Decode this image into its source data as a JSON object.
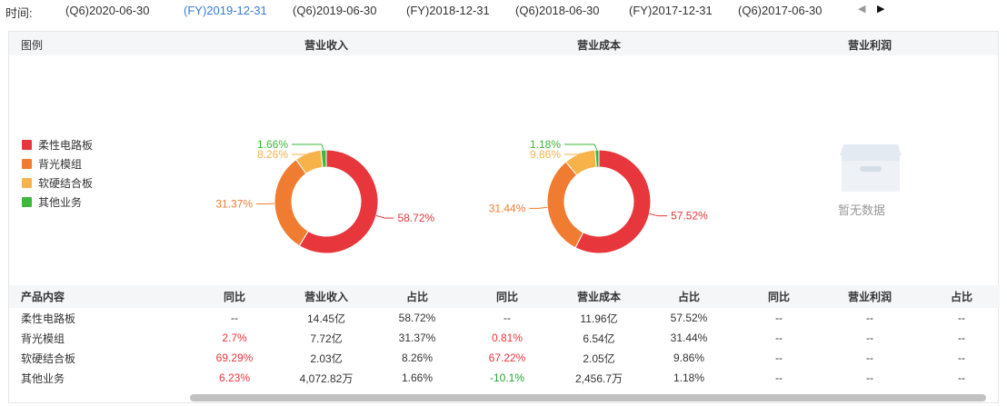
{
  "period_bar": {
    "label": "时间:",
    "tabs": [
      {
        "label": "(Q6)2020-06-30",
        "active": false
      },
      {
        "label": "(FY)2019-12-31",
        "active": true
      },
      {
        "label": "(Q6)2019-06-30",
        "active": false
      },
      {
        "label": "(FY)2018-12-31",
        "active": false
      },
      {
        "label": "(Q6)2018-06-30",
        "active": false
      },
      {
        "label": "(FY)2017-12-31",
        "active": false
      },
      {
        "label": "(Q6)2017-06-30",
        "active": false
      }
    ],
    "prev_icon": "caret-left-icon",
    "next_icon": "caret-right-icon"
  },
  "panel": {
    "legend_title": "图例",
    "legend": [
      {
        "label": "柔性电路板",
        "color": "#e8373c"
      },
      {
        "label": "背光模组",
        "color": "#f07c32"
      },
      {
        "label": "软硬结合板",
        "color": "#f7b24a"
      },
      {
        "label": "其他业务",
        "color": "#3db83a"
      }
    ],
    "empty_text": "暂无数据",
    "empty_icon": "empty-box-icon"
  },
  "chart_data": [
    {
      "type": "pie",
      "title": "营业收入",
      "categories": [
        "柔性电路板",
        "背光模组",
        "软硬结合板",
        "其他业务"
      ],
      "values": [
        58.72,
        31.37,
        8.26,
        1.66
      ],
      "labels": [
        "58.72%",
        "31.37%",
        "8.26%",
        "1.66%"
      ],
      "colors": [
        "#e8373c",
        "#f07c32",
        "#f7b24a",
        "#3db83a"
      ]
    },
    {
      "type": "pie",
      "title": "营业成本",
      "categories": [
        "柔性电路板",
        "背光模组",
        "软硬结合板",
        "其他业务"
      ],
      "values": [
        57.52,
        31.44,
        9.86,
        1.18
      ],
      "labels": [
        "57.52%",
        "31.44%",
        "9.86%",
        "1.18%"
      ],
      "colors": [
        "#e8373c",
        "#f07c32",
        "#f7b24a",
        "#3db83a"
      ]
    },
    {
      "type": "pie",
      "title": "营业利润",
      "categories": [],
      "values": []
    }
  ],
  "table": {
    "headers": [
      "产品内容",
      "同比",
      "营业收入",
      "占比",
      "同比",
      "营业成本",
      "占比",
      "同比",
      "营业利润",
      "占比"
    ],
    "rows": [
      {
        "cells": [
          {
            "text": "柔性电路板"
          },
          {
            "text": "--"
          },
          {
            "text": "14.45亿"
          },
          {
            "text": "58.72%"
          },
          {
            "text": "--"
          },
          {
            "text": "11.96亿"
          },
          {
            "text": "57.52%"
          },
          {
            "text": "--"
          },
          {
            "text": "--"
          },
          {
            "text": "--"
          }
        ]
      },
      {
        "cells": [
          {
            "text": "背光模组"
          },
          {
            "text": "2.7%",
            "tone": "red"
          },
          {
            "text": "7.72亿"
          },
          {
            "text": "31.37%"
          },
          {
            "text": "0.81%",
            "tone": "red"
          },
          {
            "text": "6.54亿"
          },
          {
            "text": "31.44%"
          },
          {
            "text": "--"
          },
          {
            "text": "--"
          },
          {
            "text": "--"
          }
        ]
      },
      {
        "cells": [
          {
            "text": "软硬结合板"
          },
          {
            "text": "69.29%",
            "tone": "red"
          },
          {
            "text": "2.03亿"
          },
          {
            "text": "8.26%"
          },
          {
            "text": "67.22%",
            "tone": "red"
          },
          {
            "text": "2.05亿"
          },
          {
            "text": "9.86%"
          },
          {
            "text": "--"
          },
          {
            "text": "--"
          },
          {
            "text": "--"
          }
        ]
      },
      {
        "cells": [
          {
            "text": "其他业务"
          },
          {
            "text": "6.23%",
            "tone": "red"
          },
          {
            "text": "4,072.82万"
          },
          {
            "text": "1.66%"
          },
          {
            "text": "-10.1%",
            "tone": "green"
          },
          {
            "text": "2,456.7万"
          },
          {
            "text": "1.18%"
          },
          {
            "text": "--"
          },
          {
            "text": "--"
          },
          {
            "text": "--"
          }
        ]
      }
    ]
  }
}
